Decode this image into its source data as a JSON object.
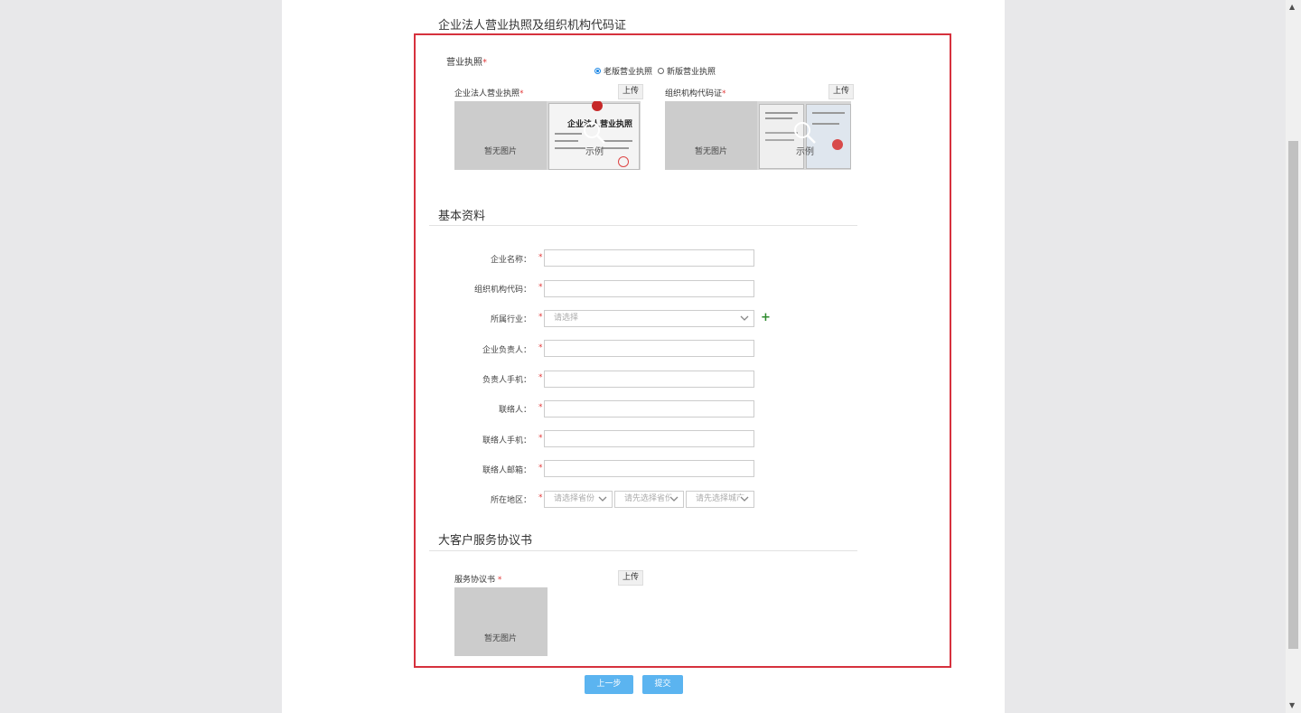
{
  "license_section": {
    "title": "企业法人营业执照及组织机构代码证",
    "biz_license_label": "营业执照",
    "required_mark": "*",
    "radio_old": "老版营业执照",
    "radio_new": "新版营业执照",
    "radio_selected": "old",
    "corp_license_label": "企业法人营业执照",
    "org_code_label": "组织机构代码证",
    "upload_label": "上传",
    "no_image_label": "暂无图片",
    "sample_label": "示例",
    "sample_doc_title": "企业法人营业执照"
  },
  "basic_section": {
    "title": "基本资料",
    "fields": [
      {
        "label": "企业名称：",
        "value": ""
      },
      {
        "label": "组织机构代码：",
        "value": ""
      },
      {
        "label": "所属行业：",
        "placeholder": "请选择"
      },
      {
        "label": "企业负责人：",
        "value": ""
      },
      {
        "label": "负责人手机：",
        "value": ""
      },
      {
        "label": "联络人：",
        "value": ""
      },
      {
        "label": "联络人手机：",
        "value": ""
      },
      {
        "label": "联络人邮箱：",
        "value": ""
      },
      {
        "label": "所在地区：",
        "province_placeholder": "请选择省份",
        "city_placeholder": "请先选择省份",
        "district_placeholder": "请先选择城市"
      }
    ],
    "industry_add": "+"
  },
  "agreement_section": {
    "title": "大客户服务协议书",
    "doc_label": "服务协议书",
    "upload_label": "上传",
    "no_image_label": "暂无图片"
  },
  "actions": {
    "prev_label": "上一步",
    "submit_label": "提交"
  },
  "colors": {
    "frame_border": "#d6313d",
    "primary_button": "#5bb4f0",
    "required": "#e23b3b",
    "radio_active": "#1e88e5"
  }
}
